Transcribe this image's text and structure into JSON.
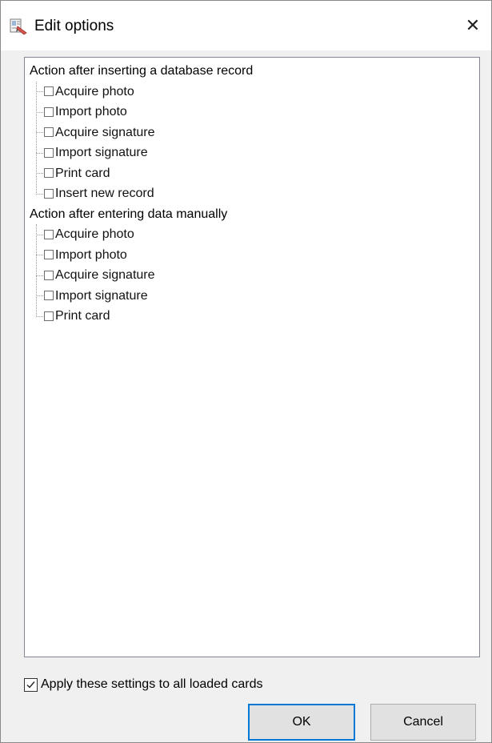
{
  "window": {
    "title": "Edit options",
    "icon": "card-app-icon",
    "close_glyph": "✕"
  },
  "tree": {
    "groups": [
      {
        "label": "Action after inserting a database record",
        "items": [
          {
            "label": "Acquire photo",
            "checked": false
          },
          {
            "label": "Import photo",
            "checked": false
          },
          {
            "label": "Acquire signature",
            "checked": false
          },
          {
            "label": "Import signature",
            "checked": false
          },
          {
            "label": "Print card",
            "checked": false
          },
          {
            "label": "Insert new record",
            "checked": false
          }
        ]
      },
      {
        "label": "Action after entering data manually",
        "items": [
          {
            "label": "Acquire photo",
            "checked": false
          },
          {
            "label": "Import photo",
            "checked": false
          },
          {
            "label": "Acquire signature",
            "checked": false
          },
          {
            "label": "Import signature",
            "checked": false
          },
          {
            "label": "Print card",
            "checked": false
          }
        ]
      }
    ]
  },
  "apply_all": {
    "label": "Apply these settings to all loaded cards",
    "checked": true
  },
  "buttons": {
    "ok_label": "OK",
    "cancel_label": "Cancel"
  },
  "colors": {
    "default_button_border": "#0078d7",
    "panel_border": "#828790"
  }
}
